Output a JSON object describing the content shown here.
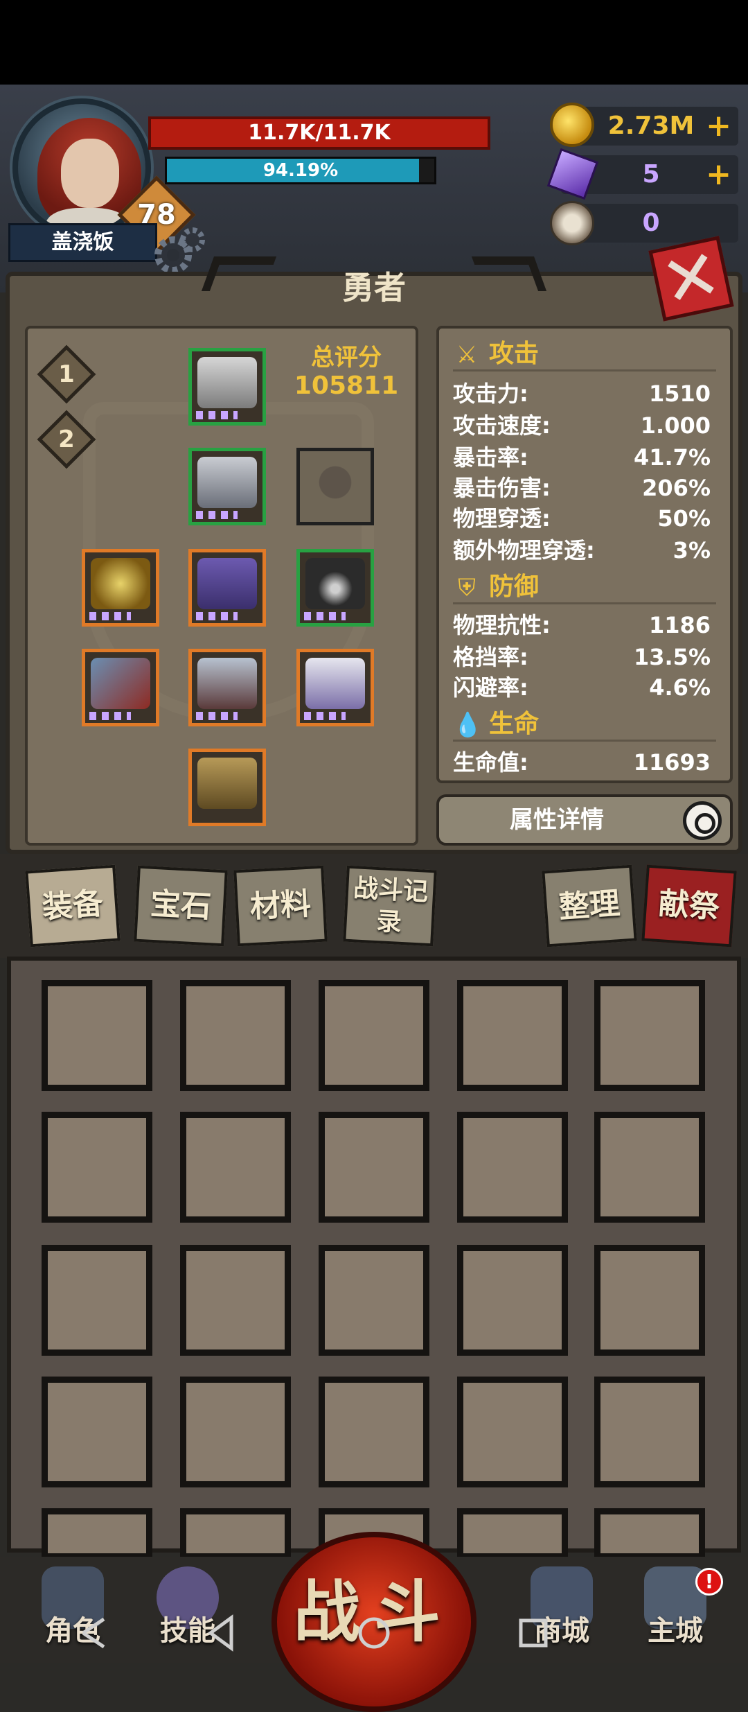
{
  "player": {
    "name": "盖浇饭",
    "level": "78",
    "hp_text": "11.7K/11.7K",
    "xp_text": "94.19%",
    "xp_fraction": 0.9419
  },
  "resources": {
    "gold": "2.73M",
    "gems": "5",
    "horns": "0"
  },
  "panel": {
    "title": "勇者",
    "score_label": "总评分",
    "score_value": "105811",
    "loadouts": [
      "1",
      "2"
    ]
  },
  "stats": {
    "attack_header": "攻击",
    "attack": [
      {
        "k": "攻击力:",
        "v": "1510"
      },
      {
        "k": "攻击速度:",
        "v": "1.000"
      },
      {
        "k": "暴击率:",
        "v": "41.7%"
      },
      {
        "k": "暴击伤害:",
        "v": "206%"
      },
      {
        "k": "物理穿透:",
        "v": "50%"
      },
      {
        "k": "额外物理穿透:",
        "v": "3%"
      }
    ],
    "defense_header": "防御",
    "defense": [
      {
        "k": "物理抗性:",
        "v": "1186"
      },
      {
        "k": "格挡率:",
        "v": "13.5%"
      },
      {
        "k": "闪避率:",
        "v": "4.6%"
      }
    ],
    "life_header": "生命",
    "life": [
      {
        "k": "生命值:",
        "v": "11693"
      }
    ],
    "detail_button": "属性详情"
  },
  "tabs": {
    "equip": "装备",
    "gems": "宝石",
    "materials": "材料",
    "battle_log": "战斗记录",
    "sort": "整理",
    "sacrifice": "献祭"
  },
  "bottom_nav": {
    "character": "角色",
    "skills": "技能",
    "fight": "战斗",
    "shop": "商城",
    "main_city": "主城",
    "notify": "!"
  },
  "icons": {
    "coin": "coin-icon",
    "gem": "purple-gem-icon",
    "horn": "ram-horn-icon",
    "close": "close-icon",
    "settings": "gear-icon",
    "search": "search-icon"
  },
  "colors": {
    "hp": "#b41c10",
    "xp": "#1e9ab8",
    "gold_text": "#f0c23a",
    "rarity_green": "#28a142",
    "rarity_orange": "#e07a27"
  }
}
